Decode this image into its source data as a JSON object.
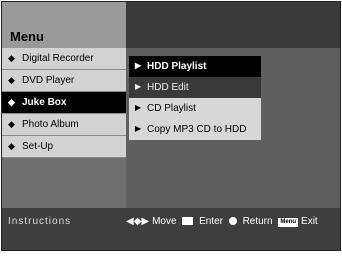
{
  "title": "Menu",
  "main_menu": [
    {
      "label": "Digital Recorder",
      "active": false
    },
    {
      "label": "DVD Player",
      "active": false
    },
    {
      "label": "Juke Box",
      "active": true
    },
    {
      "label": "Photo Album",
      "active": false
    },
    {
      "label": "Set-Up",
      "active": false
    }
  ],
  "submenu": [
    {
      "label": "HDD Playlist",
      "state": "selected"
    },
    {
      "label": "HDD Edit",
      "state": "normal"
    },
    {
      "label": "CD Playlist",
      "state": "normal"
    },
    {
      "label": "Copy MP3 CD to HDD",
      "state": "normal"
    }
  ],
  "instructions": {
    "title": "Instructions",
    "move_label": "Move",
    "enter_label": "Enter",
    "return_label": "Return",
    "exit_label": "Exit",
    "menu_key": "Menu"
  }
}
